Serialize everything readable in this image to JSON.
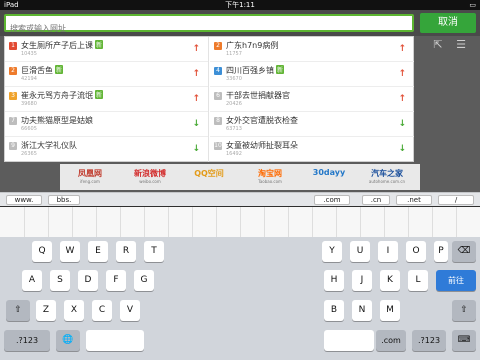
{
  "status_bar": {
    "carrier": "iPad",
    "time": "下午1:11",
    "battery": ""
  },
  "search": {
    "placeholder": "搜索或输入网址",
    "cancel_label": "取消"
  },
  "toolbar_icons": [
    "share-icon",
    "menu-icon"
  ],
  "suggestions": {
    "left": [
      {
        "rank": "1",
        "title": "女生厕所产子后上课",
        "badge": "新",
        "count": "10435",
        "trend": "up",
        "trend_glyph": "↑"
      },
      {
        "rank": "2",
        "title": "巨滑舌鱼",
        "badge": "新",
        "count": "42194",
        "trend": "up",
        "trend_glyph": "↑"
      },
      {
        "rank": "3",
        "title": "崔永元骂方舟子流氓",
        "badge": "新",
        "count": "39680",
        "trend": "up",
        "trend_glyph": "↑"
      },
      {
        "rank": "7",
        "title": "功夫熊猫原型是姑娘",
        "badge": "",
        "count": "66605",
        "trend": "down",
        "trend_glyph": "↓"
      },
      {
        "rank": "9",
        "title": "浙江大学礼仪队",
        "badge": "",
        "count": "26365",
        "trend": "down",
        "trend_glyph": "↓"
      }
    ],
    "right": [
      {
        "rank": "2",
        "title": "广东h7n9病例",
        "badge": "",
        "count": "11757",
        "trend": "up",
        "trend_glyph": "↑"
      },
      {
        "rank": "4",
        "title": "四川百强乡镇",
        "badge": "新",
        "count": "33670",
        "trend": "up",
        "trend_glyph": "↑"
      },
      {
        "rank": "6",
        "title": "干部去世捐献器官",
        "badge": "",
        "count": "20426",
        "trend": "up",
        "trend_glyph": "↑"
      },
      {
        "rank": "8",
        "title": "女外交官遭脱衣检查",
        "badge": "",
        "count": "63713",
        "trend": "down",
        "trend_glyph": "↓"
      },
      {
        "rank": "10",
        "title": "女童被幼师扯裂耳朵",
        "badge": "",
        "count": "16492",
        "trend": "down",
        "trend_glyph": "↓"
      }
    ]
  },
  "banner_logos": [
    {
      "name": "凤凰网",
      "sub": "ifeng.com",
      "color": "#c0392b"
    },
    {
      "name": "新浪微博",
      "sub": "weibo.com",
      "color": "#d32f2f"
    },
    {
      "name": "QQ空间",
      "sub": "",
      "color": "#e39b19"
    },
    {
      "name": "淘宝网",
      "sub": "Taobao.com",
      "color": "#ff6a00"
    },
    {
      "name": "30dayy",
      "sub": "",
      "color": "#2478c8"
    },
    {
      "name": "汽车之家",
      "sub": "autohome.com.cn",
      "color": "#1a4f9c"
    }
  ],
  "kb_toolbar": {
    "www": "www.",
    "bbs": "bbs.",
    "com": ".com",
    "cn": ".cn",
    "net": ".net",
    "slash": "/"
  },
  "keyboard": {
    "row1": [
      "Q",
      "W",
      "E",
      "R",
      "T",
      "Y",
      "U",
      "I",
      "O",
      "P"
    ],
    "row2": [
      "A",
      "S",
      "D",
      "F",
      "G",
      "H",
      "J",
      "K",
      "L"
    ],
    "row3": [
      "Z",
      "X",
      "C",
      "V",
      "B",
      "N",
      "M"
    ],
    "go_label": "前往",
    "mode_label": ".?123",
    "com_label": ".com",
    "backspace_glyph": "⌫",
    "shift_glyph": "⇧",
    "globe_glyph": "🌐",
    "hide_glyph": "⌨"
  }
}
